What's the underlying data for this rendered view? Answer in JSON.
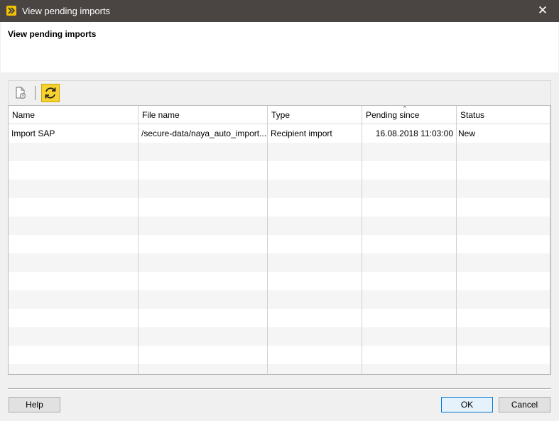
{
  "window": {
    "title": "View pending imports",
    "close_glyph": "✕"
  },
  "header": {
    "title": "View pending imports"
  },
  "toolbar": {
    "items": [
      {
        "icon": "document-clock-icon"
      },
      {
        "icon": "refresh-icon",
        "accent": "#f7d22f"
      }
    ]
  },
  "grid": {
    "columns": [
      "Name",
      "File name",
      "Type",
      "Pending since",
      "Status"
    ],
    "sort_column": "Pending since",
    "sort_glyph": "^",
    "rows": [
      {
        "name": "Import SAP",
        "file_name": "/secure-data/naya_auto_import...",
        "type": "Recipient import",
        "pending_since": "16.08.2018 11:03:00",
        "status": "New"
      }
    ]
  },
  "buttons": {
    "help": "Help",
    "ok": "OK",
    "cancel": "Cancel"
  },
  "colors": {
    "titlebar": "#4a4442",
    "accent": "#f7d22f",
    "primary_border": "#0078d7"
  }
}
